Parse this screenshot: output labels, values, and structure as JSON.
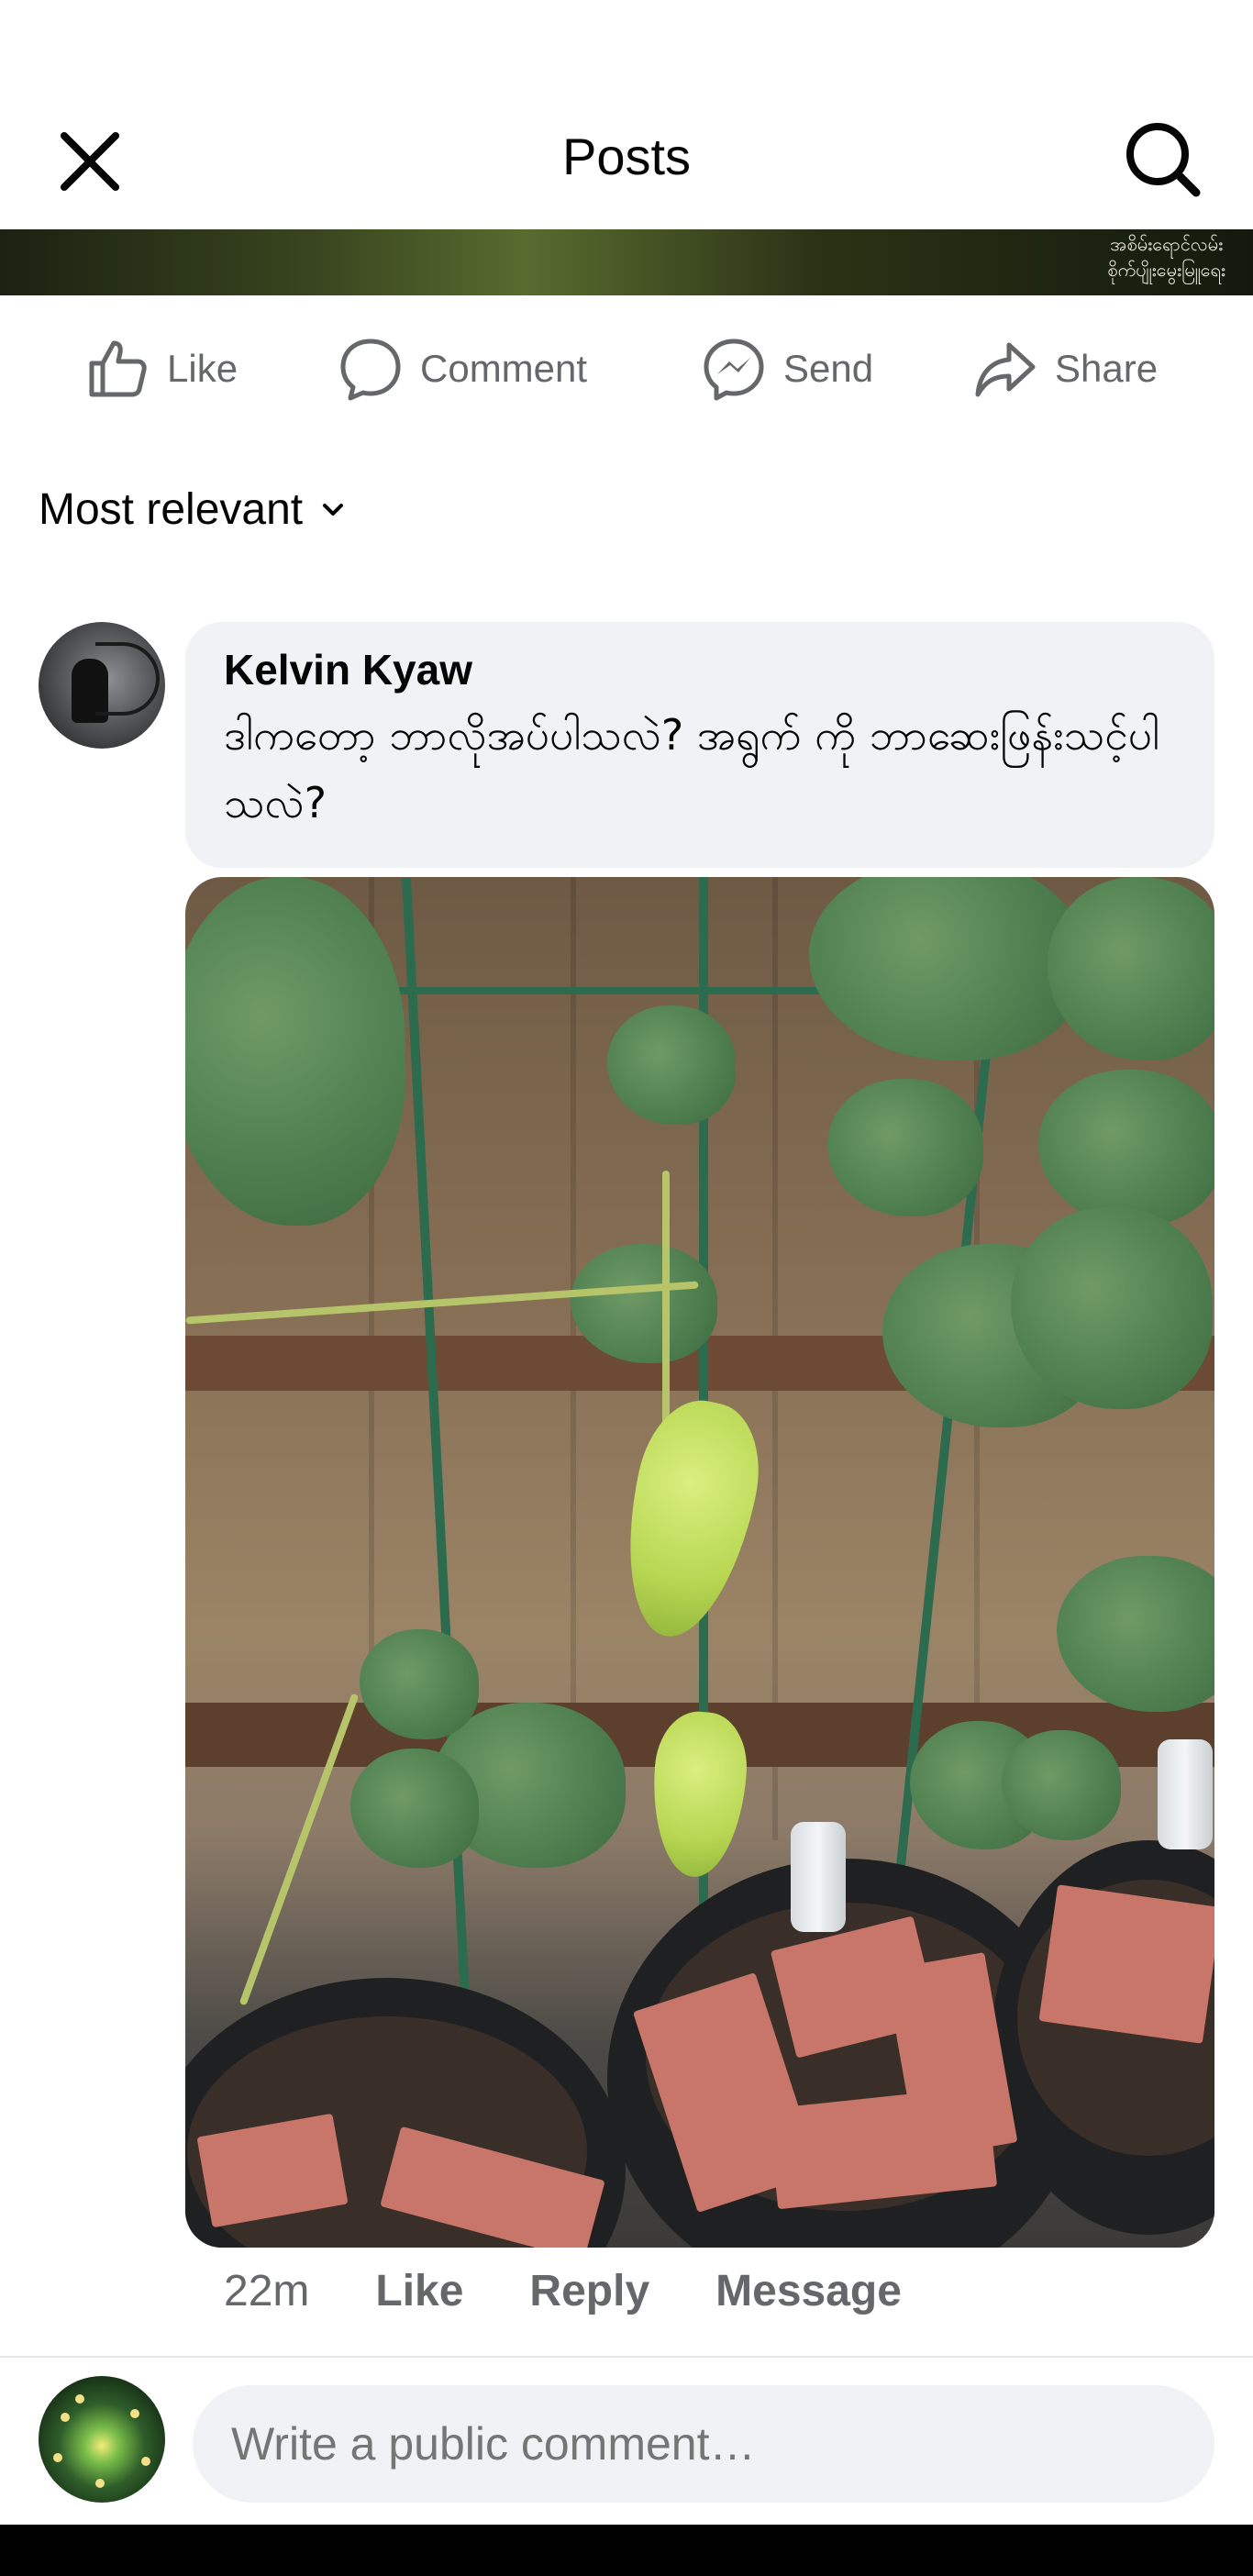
{
  "header": {
    "title": "Posts",
    "close_icon": "close-icon",
    "search_icon": "search-icon"
  },
  "banner": {
    "text_line1": "အစိမ်းရောင်လမ်း",
    "text_line2": "စိုက်ပျိုးမွေးမြူရေး"
  },
  "post_actions": [
    {
      "label": "Like",
      "icon": "thumbs-up-icon"
    },
    {
      "label": "Comment",
      "icon": "comment-icon"
    },
    {
      "label": "Send",
      "icon": "messenger-icon"
    },
    {
      "label": "Share",
      "icon": "share-icon"
    }
  ],
  "sort": {
    "label": "Most relevant",
    "icon": "chevron-down-icon"
  },
  "comment": {
    "author": "Kelvin Kyaw",
    "text": "ဒါကတော့ ဘာလိုအပ်ပါသလဲ? အရွက် ကို ဘာဆေးဖြန်းသင့်ပါသလဲ?",
    "time": "22m",
    "actions": {
      "like": "Like",
      "reply": "Reply",
      "message": "Message"
    }
  },
  "composer": {
    "placeholder": "Write a public comment…"
  },
  "colors": {
    "secondary_text": "#65676b",
    "bubble_bg": "#f0f2f5",
    "primary_text": "#050505"
  }
}
